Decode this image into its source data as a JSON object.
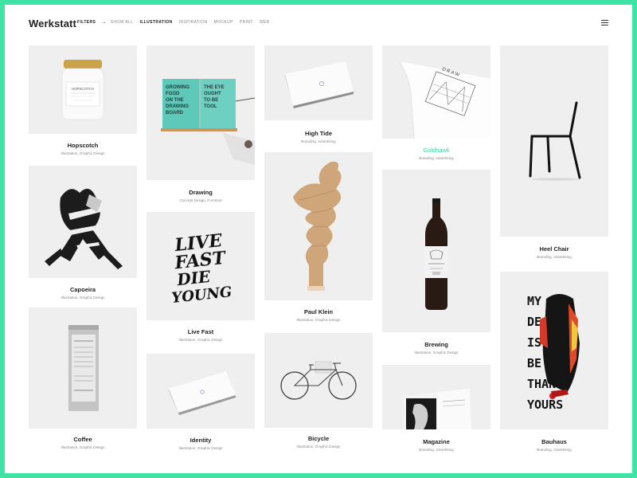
{
  "header": {
    "logo": "Werkstatt",
    "filters_label": "FILTERS",
    "arrow": "→",
    "nav": [
      "SHOW ALL",
      "ILLUSTRATION",
      "INSPIRATION",
      "MOCKUP",
      "PRINT",
      "WEB"
    ]
  },
  "projects": {
    "hopscotch": {
      "title": "Hopscotch",
      "cats": "Illustration, Graphic Design",
      "jar_label": "HOPSCOTCH"
    },
    "capoeira": {
      "title": "Capoeira",
      "cats": "Illustration, Graphic Design"
    },
    "coffee": {
      "title": "Coffee",
      "cats": "Illustration, Graphic Design"
    },
    "drawing": {
      "title": "Drawing",
      "cats": "Concept Design, Furniture",
      "book1": "GROWING FOOD ON THE DRAWING BOARD",
      "book2": "THE EYE OUGHT TO BE TOOL"
    },
    "livefast": {
      "title": "Live Fast",
      "cats": "Illustration, Graphic Design",
      "lettering": [
        "LIVE",
        "FAST",
        "DIE",
        "YOUNG"
      ]
    },
    "identity": {
      "title": "Identity",
      "cats": "Illustration, Graphic Design"
    },
    "hightide": {
      "title": "High Tide",
      "cats": "Branding, Advertising"
    },
    "paulklein": {
      "title": "Paul Klein",
      "cats": "Illustration, Graphic Design"
    },
    "bicycle": {
      "title": "Bicycle",
      "cats": "Illustration, Graphic Design"
    },
    "goldhawk": {
      "title": "Goldhawk",
      "cats": "Branding, Advertising",
      "paper_text": "DRAW"
    },
    "brewing": {
      "title": "Brewing",
      "cats": "Illustration, Graphic Design"
    },
    "magazine": {
      "title": "Magazine",
      "cats": "Branding, Advertising"
    },
    "heelchair": {
      "title": "Heel Chair",
      "cats": "Branding, Advertising"
    },
    "bauhaus": {
      "title": "Bauhaus",
      "cats": "Branding, Advertising",
      "poster_lines": [
        "MY",
        "DE  US",
        "IS",
        "BE  ER",
        "THAN",
        "YOURS"
      ]
    }
  },
  "colors": {
    "frame": "#3fe3a6",
    "highlight": "#2fd99a",
    "tile": "#efefef"
  }
}
